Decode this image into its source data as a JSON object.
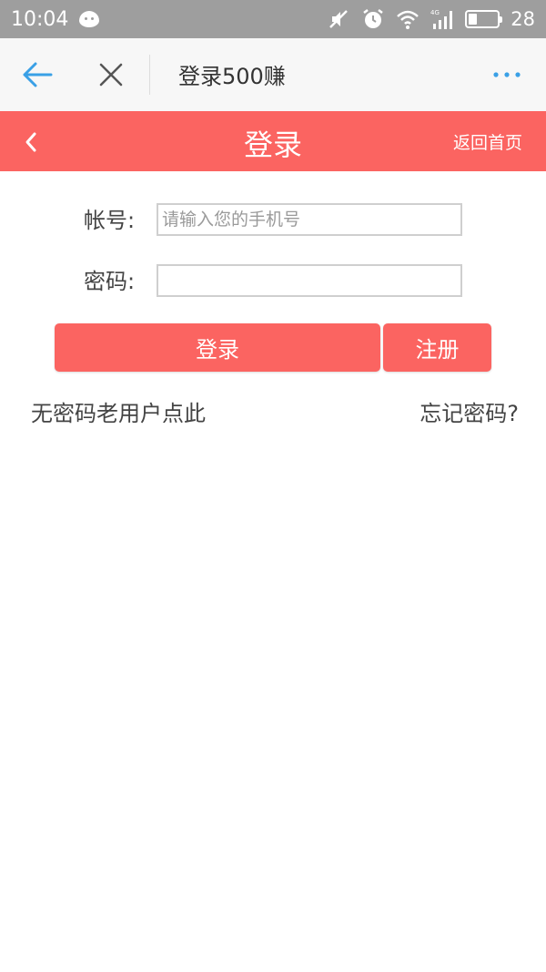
{
  "status_bar": {
    "time": "10:04",
    "battery_level": "28",
    "battery_fraction": 0.28,
    "icons": [
      "wechat-icon",
      "mute-icon",
      "alarm-icon",
      "wifi-icon",
      "4g-signal-icon",
      "battery-icon"
    ]
  },
  "browser": {
    "title": "登录500赚",
    "icons": [
      "back-arrow-icon",
      "close-icon",
      "more-icon"
    ],
    "accent_color": "#3aa0e6"
  },
  "header": {
    "title": "登录",
    "home_link": "返回首页",
    "color": "#fb6461"
  },
  "form": {
    "account_label": "帐号:",
    "account_placeholder": "请输入您的手机号",
    "account_value": "",
    "password_label": "密码:",
    "password_value": ""
  },
  "actions": {
    "login_label": "登录",
    "register_label": "注册",
    "no_password_link": "无密码老用户点此",
    "forgot_password_link": "忘记密码?"
  }
}
